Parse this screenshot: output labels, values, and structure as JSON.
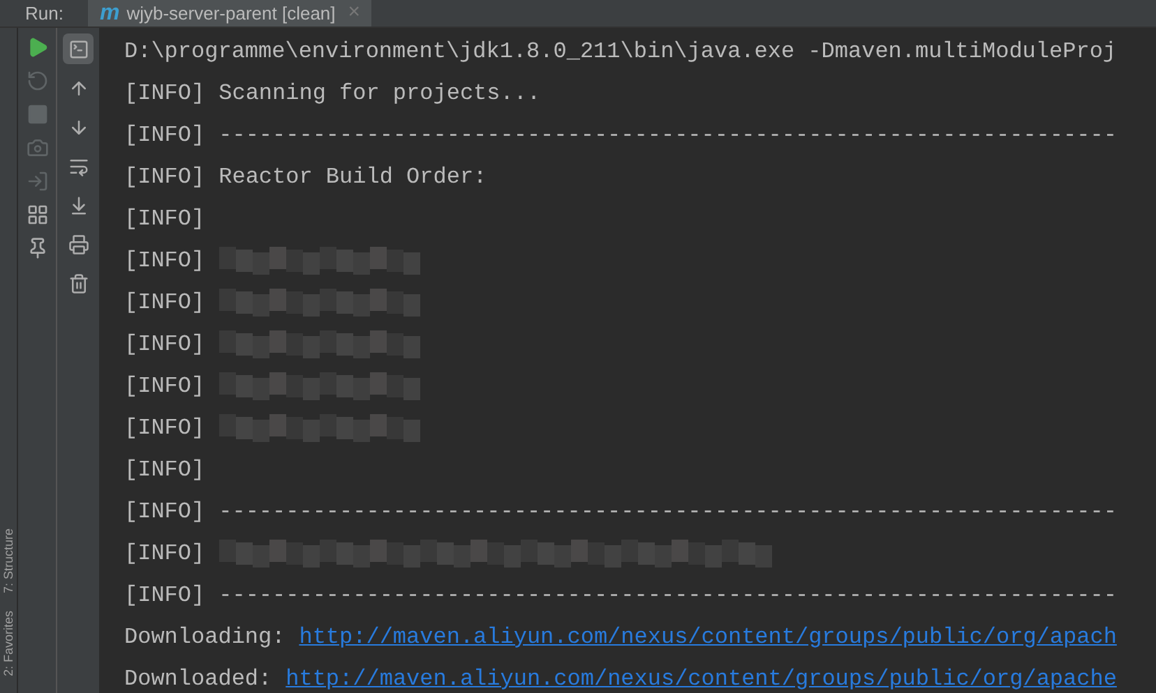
{
  "run_bar": {
    "label": "Run:",
    "tabs": [
      {
        "icon_letter": "m",
        "title": "wjyb-server-parent [clean]",
        "close": "×",
        "selected": true
      }
    ]
  },
  "side_stripe": [
    "7: Structure",
    "2: Favorites"
  ],
  "left_tools": [
    {
      "kind": "run",
      "disabled": false
    },
    {
      "kind": "rerun",
      "disabled": true
    },
    {
      "kind": "stop",
      "disabled": true
    },
    {
      "kind": "camera",
      "disabled": true
    },
    {
      "kind": "exit",
      "disabled": true
    },
    {
      "kind": "layout",
      "disabled": false
    },
    {
      "kind": "pin",
      "disabled": false
    }
  ],
  "console_tools": [
    {
      "kind": "console",
      "selected": true
    },
    {
      "kind": "up",
      "selected": false
    },
    {
      "kind": "down",
      "selected": false
    },
    {
      "kind": "wrap",
      "selected": false
    },
    {
      "kind": "scroll-end",
      "selected": false
    },
    {
      "kind": "print",
      "selected": false
    },
    {
      "kind": "trash",
      "selected": false
    }
  ],
  "console_lines": [
    {
      "kind": "plain",
      "text": "D:\\programme\\environment\\jdk1.8.0_211\\bin\\java.exe -Dmaven.multiModuleProj"
    },
    {
      "kind": "info",
      "prefix": "[INFO]",
      "text": "Scanning for projects..."
    },
    {
      "kind": "info",
      "prefix": "[INFO]",
      "text": "-------------------------------------------------------------------"
    },
    {
      "kind": "info",
      "prefix": "[INFO]",
      "text": "Reactor Build Order:"
    },
    {
      "kind": "empty",
      "prefix": "[INFO]"
    },
    {
      "kind": "redacted",
      "prefix": "[INFO]"
    },
    {
      "kind": "redacted",
      "prefix": "[INFO]"
    },
    {
      "kind": "redacted",
      "prefix": "[INFO]"
    },
    {
      "kind": "redacted",
      "prefix": "[INFO]"
    },
    {
      "kind": "redacted",
      "prefix": "[INFO]"
    },
    {
      "kind": "empty",
      "prefix": "[INFO]"
    },
    {
      "kind": "info",
      "prefix": "[INFO]",
      "text": "-------------------------------------------------------------------"
    },
    {
      "kind": "redacted",
      "prefix": "[INFO]"
    },
    {
      "kind": "info",
      "prefix": "[INFO]",
      "text": "-------------------------------------------------------------------"
    },
    {
      "kind": "link",
      "prefix": "Downloading:",
      "url": "http://maven.aliyun.com/nexus/content/groups/public/org/apach"
    },
    {
      "kind": "link",
      "prefix": "Downloaded:",
      "url": "http://maven.aliyun.com/nexus/content/groups/public/org/apache"
    }
  ]
}
